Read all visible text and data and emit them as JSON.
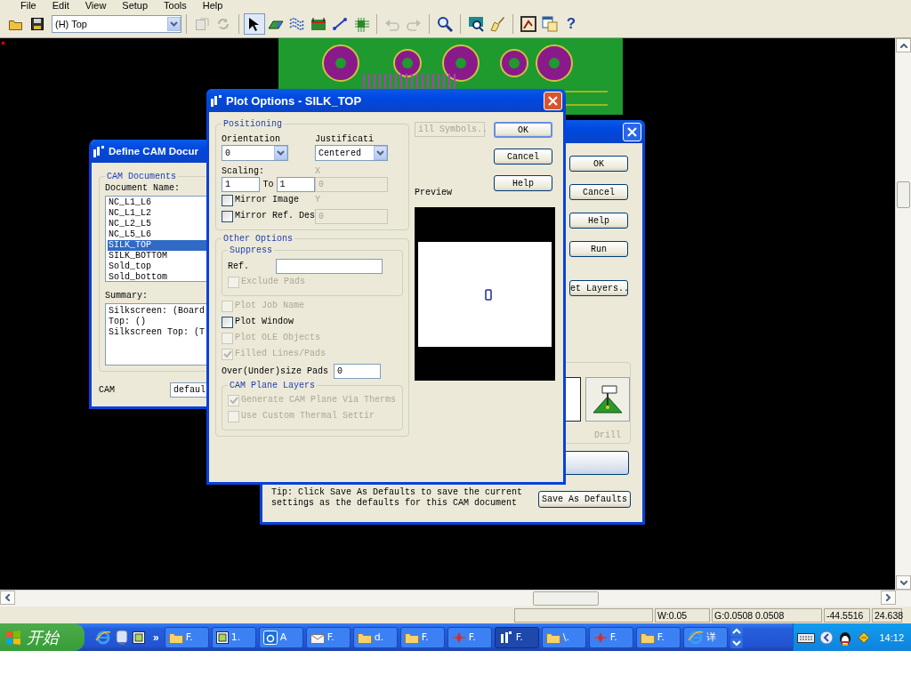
{
  "menu": [
    "File",
    "Edit",
    "View",
    "Setup",
    "Tools",
    "Help"
  ],
  "toolbar": {
    "file_tools": [
      {
        "kind": "open",
        "pressed": false,
        "disabled": false
      },
      {
        "kind": "save",
        "pressed": false,
        "disabled": false
      }
    ],
    "layer": "(H) Top",
    "tool_groups": [
      [
        {
          "kind": "properties",
          "pressed": false,
          "disabled": true
        },
        {
          "kind": "refresh",
          "pressed": false,
          "disabled": true
        }
      ],
      [
        {
          "kind": "pointer",
          "pressed": true,
          "disabled": false
        },
        {
          "kind": "shape",
          "pressed": false,
          "disabled": false
        },
        {
          "kind": "traces",
          "pressed": false,
          "disabled": false
        },
        {
          "kind": "board",
          "pressed": false,
          "disabled": false
        },
        {
          "kind": "route",
          "pressed": false,
          "disabled": false
        },
        {
          "kind": "part",
          "pressed": false,
          "disabled": false
        }
      ],
      [
        {
          "kind": "undo",
          "pressed": false,
          "disabled": true
        },
        {
          "kind": "redo",
          "pressed": false,
          "disabled": true
        }
      ],
      [
        {
          "kind": "zoom",
          "pressed": false,
          "disabled": false
        }
      ],
      [
        {
          "kind": "monitor",
          "pressed": false,
          "disabled": false
        },
        {
          "kind": "brush",
          "pressed": false,
          "disabled": false
        }
      ],
      [
        {
          "kind": "frame",
          "pressed": false,
          "disabled": false
        },
        {
          "kind": "window",
          "pressed": false,
          "disabled": false
        },
        {
          "kind": "help",
          "pressed": false,
          "disabled": false,
          "glyph": "?"
        }
      ]
    ]
  },
  "define_cam_dialog": {
    "title": "Define CAM Docur",
    "group_title": "CAM Documents",
    "list_label": "Document Name:",
    "documents": [
      {
        "name": "NC_L1_L6",
        "selected": false
      },
      {
        "name": "NC_L1_L2",
        "selected": false
      },
      {
        "name": "NC_L2_L5",
        "selected": false
      },
      {
        "name": "NC_L5_L6",
        "selected": false
      },
      {
        "name": "SILK_TOP",
        "selected": true
      },
      {
        "name": "SILK_BOTTOM",
        "selected": false
      },
      {
        "name": "Sold_top",
        "selected": false
      },
      {
        "name": "Sold_bottom",
        "selected": false
      }
    ],
    "summary_label": "Summary:",
    "summary_lines": [
      "Silkscreen: (Board",
      "Top: ()",
      "Silkscreen Top: (T"
    ],
    "cam_label": "CAM",
    "cam_value": "defaul"
  },
  "document_dialog": {
    "buttons": [
      "OK",
      "Cancel",
      "Help",
      "Run"
    ],
    "layers_button": "et Layers..",
    "device_label": "Drill",
    "tip_lines": [
      "Tip: Click Save As Defaults to save the current",
      "settings as the defaults for this CAM document"
    ],
    "save_defaults": "Save As Defaults"
  },
  "plot_dialog": {
    "title": "Plot Options - SILK_TOP",
    "positioning": {
      "title": "Positioning",
      "orientation_label": "Orientation",
      "orientation": "0",
      "justification_label": "Justificati",
      "justification": "Centered",
      "scaling_label": "Scaling:",
      "scale_from": "1",
      "to_label": "To",
      "scale_to": "1",
      "x_label": "X",
      "x_value": "0",
      "y_label": "Y",
      "y_value": "0",
      "options": [
        {
          "label": "Mirror Image",
          "checked": false,
          "disabled": false
        },
        {
          "label": "Mirror Ref. Des",
          "checked": false,
          "disabled": false
        }
      ]
    },
    "other": {
      "title": "Other Options",
      "suppress_title": "Suppress",
      "ref_label": "Ref.",
      "exclude": {
        "label": "Exclude Pads",
        "checked": false,
        "disabled": true
      },
      "options": [
        {
          "label": "Plot Job Name",
          "checked": false,
          "disabled": true
        },
        {
          "label": "Plot Window",
          "checked": false,
          "disabled": false
        },
        {
          "label": "Plot OLE Objects",
          "checked": false,
          "disabled": true
        },
        {
          "label": "Filled Lines/Pads",
          "checked": true,
          "disabled": true
        }
      ],
      "oversize_label": "Over(Under)size Pads",
      "oversize_value": "0",
      "plane_title": "CAM Plane Layers",
      "plane_options": [
        {
          "label": "Generate CAM Plane Via Therms",
          "checked": true,
          "disabled": true
        },
        {
          "label": "Use Custom Thermal Settir",
          "checked": false,
          "disabled": true
        }
      ]
    },
    "drill_symbols": "ill Symbols..",
    "buttons": [
      {
        "label": "OK",
        "default": true
      },
      {
        "label": "Cancel",
        "default": false
      },
      {
        "label": "Help",
        "default": false
      }
    ],
    "preview_label": "Preview"
  },
  "status_bar": [
    "W:0.05",
    "G:0.0508 0.0508",
    "-44.5516",
    "24.638"
  ],
  "taskbar": {
    "start": "开始",
    "quick_launch": [
      {
        "kind": "browser"
      },
      {
        "kind": "desktop"
      },
      {
        "kind": "app"
      }
    ],
    "more": "»",
    "tasks": [
      {
        "kind": "folder",
        "label": "F.",
        "selected": false
      },
      {
        "kind": "app",
        "label": "1.",
        "selected": false
      },
      {
        "kind": "letter",
        "label": "A",
        "selected": false
      },
      {
        "kind": "mail",
        "label": "F.",
        "selected": false
      },
      {
        "kind": "folder",
        "label": "d.",
        "selected": false
      },
      {
        "kind": "folder",
        "label": "F.",
        "selected": false
      },
      {
        "kind": "pcb",
        "label": "F.",
        "selected": false
      },
      {
        "kind": "cam",
        "label": "F.",
        "selected": true
      },
      {
        "kind": "folder",
        "label": "\\.",
        "selected": false
      },
      {
        "kind": "pcb",
        "label": "F.",
        "selected": false
      },
      {
        "kind": "folder",
        "label": "F.",
        "selected": false
      },
      {
        "kind": "browser",
        "label": "详",
        "selected": false
      }
    ],
    "clock": "14:12"
  }
}
